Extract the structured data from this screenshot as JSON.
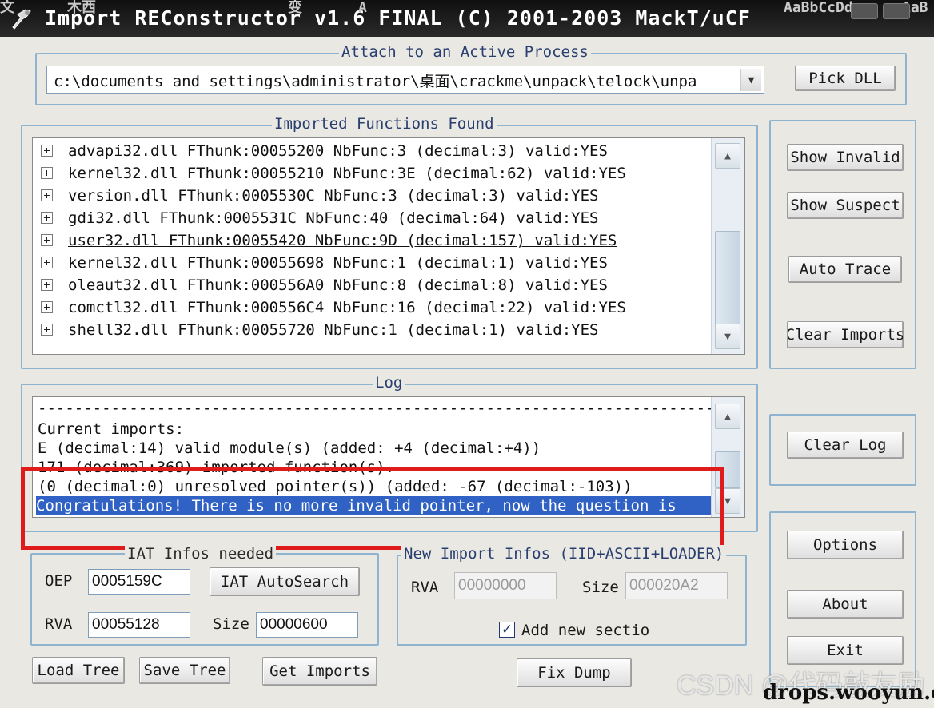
{
  "window": {
    "title": "Import REConstructor v1.6 FINAL (C) 2001-2003 MackT/uCF",
    "background_strip": [
      "文",
      "木西",
      "变",
      "A",
      "AaBbCcDd",
      "AaB"
    ]
  },
  "attach": {
    "group_title": "Attach to an Active Process",
    "process_path": "c:\\documents and settings\\administrator\\桌面\\crackme\\unpack\\telock\\unpa",
    "pick_dll_label": "Pick DLL"
  },
  "imports": {
    "group_title": "Imported Functions Found",
    "items": [
      {
        "text": "advapi32.dll FThunk:00055200 NbFunc:3 (decimal:3) valid:YES"
      },
      {
        "text": "kernel32.dll FThunk:00055210 NbFunc:3E (decimal:62) valid:YES"
      },
      {
        "text": "version.dll FThunk:0005530C NbFunc:3 (decimal:3) valid:YES"
      },
      {
        "text": "gdi32.dll FThunk:0005531C NbFunc:40 (decimal:64) valid:YES"
      },
      {
        "text": "user32.dll FThunk:00055420 NbFunc:9D (decimal:157) valid:YES",
        "selected": true
      },
      {
        "text": "kernel32.dll FThunk:00055698 NbFunc:1 (decimal:1) valid:YES"
      },
      {
        "text": "oleaut32.dll FThunk:000556A0 NbFunc:8 (decimal:8) valid:YES"
      },
      {
        "text": "comctl32.dll FThunk:000556C4 NbFunc:16 (decimal:22) valid:YES"
      },
      {
        "text": "shell32.dll FThunk:00055720 NbFunc:1 (decimal:1) valid:YES"
      }
    ]
  },
  "side_buttons": {
    "show_invalid": "Show Invalid",
    "show_suspect": "Show Suspect",
    "auto_trace": "Auto Trace",
    "clear_imports": "Clear Imports",
    "clear_log": "Clear Log",
    "options": "Options",
    "about": "About",
    "exit": "Exit"
  },
  "log": {
    "group_title": "Log",
    "lines": [
      "------------------------------------------------------------------------------",
      "Current imports:",
      "E (decimal:14) valid module(s) (added: +4 (decimal:+4))",
      "171 (decimal:369) imported function(s).",
      " (0 (decimal:0) unresolved pointer(s)) (added: -67 (decimal:-103))",
      "Congratulations! There is no more invalid pointer, now the question is"
    ],
    "selected_line_index": 5
  },
  "iat": {
    "group_title": "IAT Infos needed",
    "oep_label": "OEP",
    "oep_value": "0005159C",
    "autosearch_label": "IAT AutoSearch",
    "rva_label": "RVA",
    "rva_value": "00055128",
    "size_label": "Size",
    "size_value": "00000600"
  },
  "new_import": {
    "group_title": "New Import Infos (IID+ASCII+LOADER)",
    "rva_label": "RVA",
    "rva_value": "00000000",
    "size_label": "Size",
    "size_value": "000020A2",
    "add_section_label": "Add new sectio",
    "add_section_checked": true
  },
  "bottom_buttons": {
    "load_tree": "Load Tree",
    "save_tree": "Save Tree",
    "get_imports": "Get Imports",
    "fix_dump": "Fix Dump"
  },
  "watermark": {
    "csdn": "CSDN @代码敲友励",
    "site": "drops.wooyun.org"
  },
  "colors": {
    "title_bar": "#101010",
    "group_border": "#8fb4cf",
    "group_title": "#2a3f70",
    "selection": "#2f62c4",
    "highlight_box": "#e01b1b"
  }
}
